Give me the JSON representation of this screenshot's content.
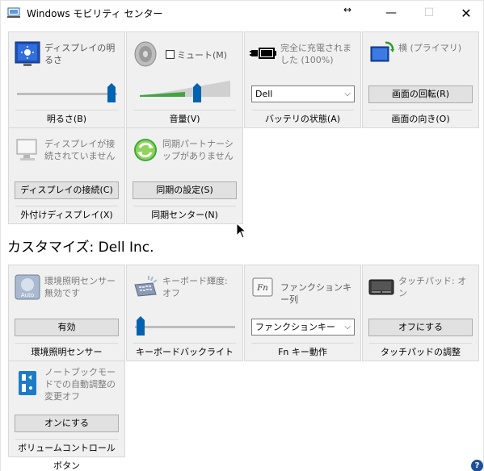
{
  "window": {
    "title": "Windows モビリティ センター",
    "resize_glyph": "↔",
    "minimize_glyph": "—",
    "maximize_glyph": "☐",
    "close_glyph": "✕"
  },
  "tiles_top": {
    "brightness": {
      "icon": "display-brightness-icon",
      "label": "ディスプレイの明るさ",
      "footer": "明るさ(B)",
      "level": 0.92
    },
    "volume": {
      "icon": "speaker-icon",
      "mute_label": "ミュート(M)",
      "mute_checked": false,
      "footer": "音量(V)",
      "level": 0.57
    },
    "battery": {
      "icon": "battery-plug-icon",
      "label": "完全に充電されました (100%)",
      "select_value": "Dell",
      "footer": "バッテリの状態(A)"
    },
    "orientation": {
      "icon": "rotate-display-icon",
      "label": "横 (プライマリ)",
      "button": "画面の回転(R)",
      "footer": "画面の向き(O)"
    },
    "external_display": {
      "icon": "monitor-icon",
      "label": "ディスプレイが接続されていません",
      "button": "ディスプレイの接続(C)",
      "footer": "外付けディスプレイ(X)"
    },
    "sync": {
      "icon": "sync-icon",
      "label": "同期パートナーシップがありません",
      "button": "同期の設定(S)",
      "footer": "同期センター(N)"
    }
  },
  "custom_section": {
    "title": "カスタマイズ: Dell Inc."
  },
  "tiles_custom": {
    "ambient": {
      "icon": "ambient-light-sensor-icon",
      "label": "環境照明センサー無効です",
      "button": "有効",
      "footer": "環境照明センサー"
    },
    "keyboard": {
      "icon": "keyboard-backlight-icon",
      "label": "キーボード輝度: オフ",
      "footer": "キーボードバックライト",
      "level": 0.0
    },
    "fnkey": {
      "icon": "fn-key-icon",
      "label": "ファンクションキー列",
      "select_value": "ファンクションキー",
      "footer": "Fn キー動作"
    },
    "touchpad": {
      "icon": "touchpad-icon",
      "label": "タッチパッド: オン",
      "button": "オフにする",
      "footer": "タッチパッドの調整"
    },
    "notebook_mode": {
      "icon": "volume-control-button-icon",
      "label": "ノートブックモードでの自動調整の変更オフ",
      "button": "オンにする",
      "footer": "ボリュームコントロールボタン"
    }
  },
  "help_glyph": "?",
  "colors": {
    "accent": "#0063b1",
    "tile_bg": "#f0f0f0",
    "muted_text": "#7a7a7a"
  }
}
